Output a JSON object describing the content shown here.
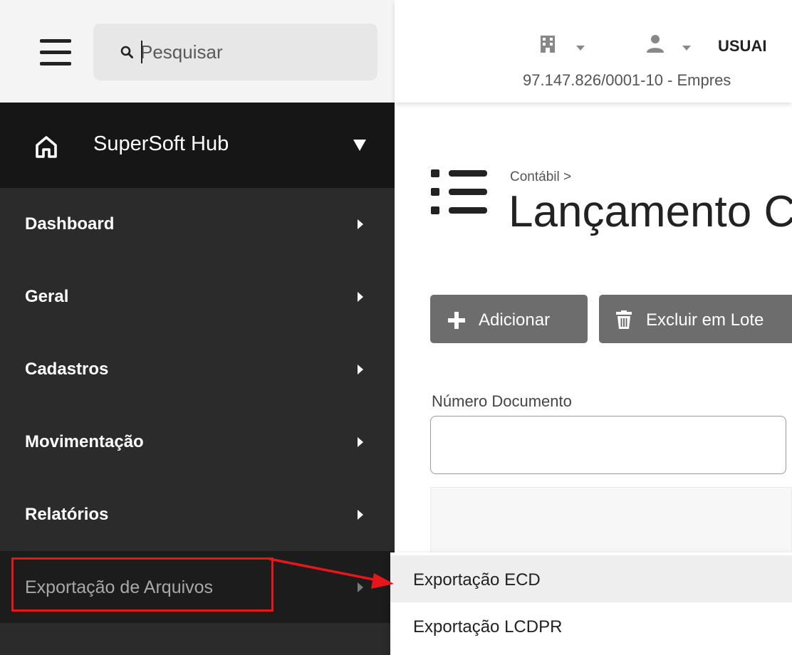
{
  "search": {
    "placeholder": "Pesquisar"
  },
  "header": {
    "username": "USUAI",
    "company": "97.147.826/0001-10 - Empres"
  },
  "sidebar": {
    "brand": "SuperSoft Hub",
    "items": [
      {
        "label": "Dashboard"
      },
      {
        "label": "Geral"
      },
      {
        "label": "Cadastros"
      },
      {
        "label": "Movimentação"
      },
      {
        "label": "Relatórios"
      },
      {
        "label": "Exportação de Arquivos"
      }
    ]
  },
  "submenu": {
    "items": [
      {
        "label": "Exportação ECD"
      },
      {
        "label": "Exportação LCDPR"
      }
    ]
  },
  "page": {
    "breadcrumb": "Contábil  >",
    "title": "Lançamento C"
  },
  "toolbar": {
    "add_label": "Adicionar",
    "delete_label": "Excluir em Lote"
  },
  "form": {
    "document_number_label": "Número Documento",
    "document_number_value": ""
  },
  "colors": {
    "sidebar_bg": "#2b2b2b",
    "brand_bg": "#161616",
    "button_bg": "#6d6d6d",
    "annotation_red": "#e8161b"
  },
  "icons": [
    "menu-icon",
    "search-icon",
    "home-icon",
    "building-icon",
    "user-icon",
    "list-icon",
    "plus-icon",
    "trash-icon"
  ]
}
